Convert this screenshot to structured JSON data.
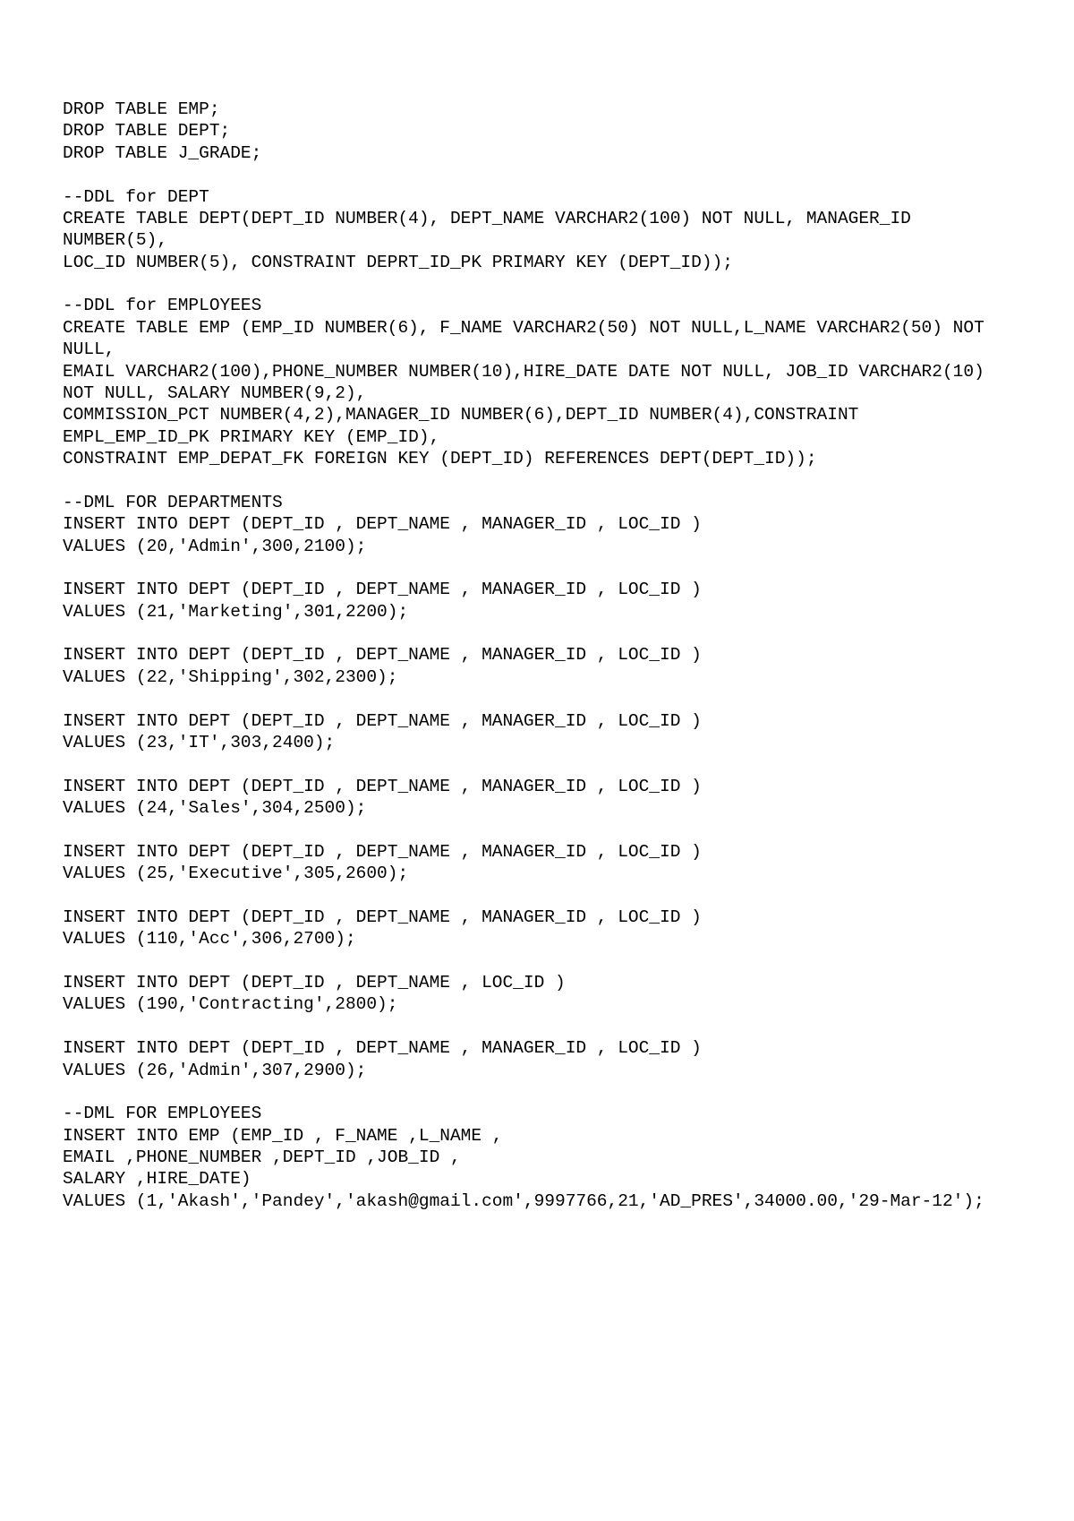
{
  "document": {
    "body": "DROP TABLE EMP;\nDROP TABLE DEPT;\nDROP TABLE J_GRADE;\n\n--DDL for DEPT\nCREATE TABLE DEPT(DEPT_ID NUMBER(4), DEPT_NAME VARCHAR2(100) NOT NULL, MANAGER_ID NUMBER(5),\nLOC_ID NUMBER(5), CONSTRAINT DEPRT_ID_PK PRIMARY KEY (DEPT_ID));\n\n--DDL for EMPLOYEES\nCREATE TABLE EMP (EMP_ID NUMBER(6), F_NAME VARCHAR2(50) NOT NULL,L_NAME VARCHAR2(50) NOT NULL,\nEMAIL VARCHAR2(100),PHONE_NUMBER NUMBER(10),HIRE_DATE DATE NOT NULL, JOB_ID VARCHAR2(10) NOT NULL, SALARY NUMBER(9,2),\nCOMMISSION_PCT NUMBER(4,2),MANAGER_ID NUMBER(6),DEPT_ID NUMBER(4),CONSTRAINT EMPL_EMP_ID_PK PRIMARY KEY (EMP_ID),\nCONSTRAINT EMP_DEPAT_FK FOREIGN KEY (DEPT_ID) REFERENCES DEPT(DEPT_ID));\n\n--DML FOR DEPARTMENTS\nINSERT INTO DEPT (DEPT_ID , DEPT_NAME , MANAGER_ID , LOC_ID )\nVALUES (20,'Admin',300,2100);\n\nINSERT INTO DEPT (DEPT_ID , DEPT_NAME , MANAGER_ID , LOC_ID )\nVALUES (21,'Marketing',301,2200);\n\nINSERT INTO DEPT (DEPT_ID , DEPT_NAME , MANAGER_ID , LOC_ID )\nVALUES (22,'Shipping',302,2300);\n\nINSERT INTO DEPT (DEPT_ID , DEPT_NAME , MANAGER_ID , LOC_ID )\nVALUES (23,'IT',303,2400);\n\nINSERT INTO DEPT (DEPT_ID , DEPT_NAME , MANAGER_ID , LOC_ID )\nVALUES (24,'Sales',304,2500);\n\nINSERT INTO DEPT (DEPT_ID , DEPT_NAME , MANAGER_ID , LOC_ID )\nVALUES (25,'Executive',305,2600);\n\nINSERT INTO DEPT (DEPT_ID , DEPT_NAME , MANAGER_ID , LOC_ID )\nVALUES (110,'Acc',306,2700);\n\nINSERT INTO DEPT (DEPT_ID , DEPT_NAME , LOC_ID )\nVALUES (190,'Contracting',2800);\n\nINSERT INTO DEPT (DEPT_ID , DEPT_NAME , MANAGER_ID , LOC_ID )\nVALUES (26,'Admin',307,2900);\n\n--DML FOR EMPLOYEES\nINSERT INTO EMP (EMP_ID , F_NAME ,L_NAME ,\nEMAIL ,PHONE_NUMBER ,DEPT_ID ,JOB_ID ,\nSALARY ,HIRE_DATE)\nVALUES (1,'Akash','Pandey','akash@gmail.com',9997766,21,'AD_PRES',34000.00,'29-Mar-12');"
  }
}
